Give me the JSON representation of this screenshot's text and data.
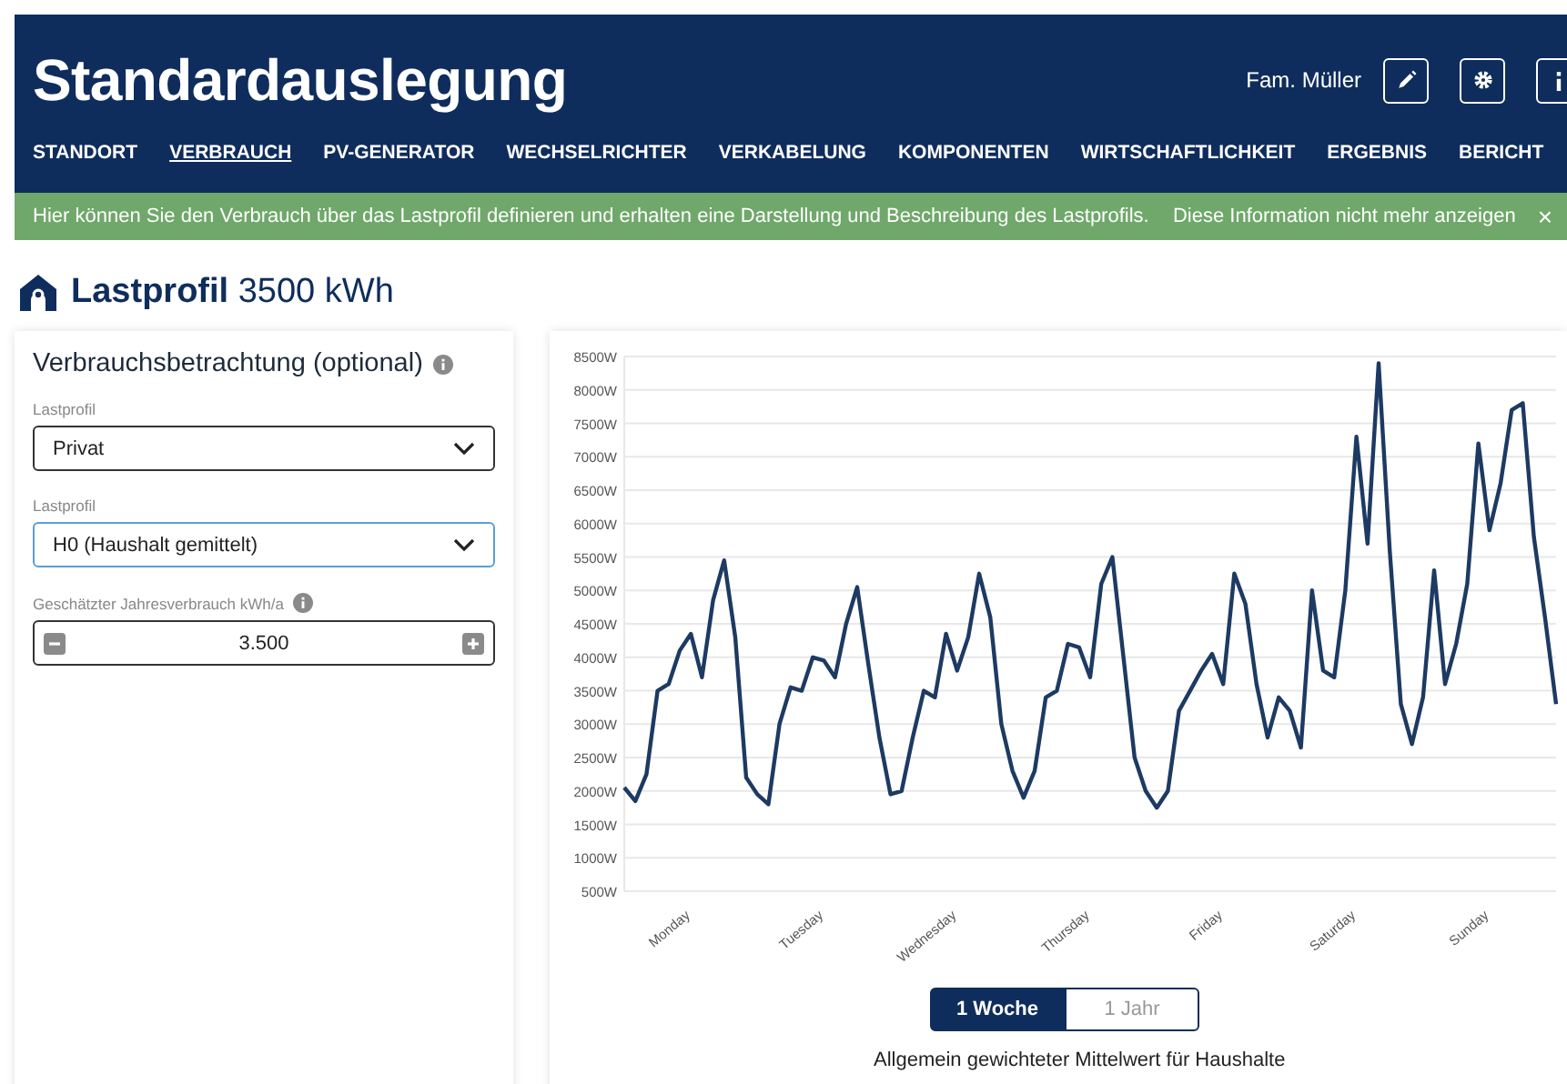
{
  "header": {
    "title": "Standardauslegung",
    "user": "Fam. Müller",
    "buttons": [
      {
        "kind": "edit"
      },
      {
        "kind": "settings"
      },
      {
        "kind": "info"
      }
    ]
  },
  "nav": [
    {
      "label": "STANDORT",
      "selected": false
    },
    {
      "label": "VERBRAUCH",
      "selected": true
    },
    {
      "label": "PV-GENERATOR",
      "selected": false
    },
    {
      "label": "WECHSELRICHTER",
      "selected": false
    },
    {
      "label": "VERKABELUNG",
      "selected": false
    },
    {
      "label": "KOMPONENTEN",
      "selected": false
    },
    {
      "label": "WIRTSCHAFTLICHKEIT",
      "selected": false
    },
    {
      "label": "ERGEBNIS",
      "selected": false
    },
    {
      "label": "BERICHT",
      "selected": false
    }
  ],
  "info_bar": {
    "text": "Hier können Sie den Verbrauch über das Lastprofil definieren und erhalten eine Darstellung und Beschreibung des Lastprofils.",
    "dismiss": "Diese Information nicht mehr anzeigen",
    "close": "×"
  },
  "section": {
    "title": "Lastprofil",
    "value": "3500 kWh"
  },
  "form": {
    "title": "Verbrauchsbetrachtung (optional)",
    "fields": [
      {
        "kind": "select",
        "label": "Lastprofil",
        "value": "Privat",
        "focused": false
      },
      {
        "kind": "select",
        "label": "Lastprofil",
        "value": "H0 (Haushalt gemittelt)",
        "focused": true
      },
      {
        "kind": "stepper",
        "label": "Geschätzter Jahresverbrauch kWh/a",
        "value": "3.500",
        "info": true
      }
    ]
  },
  "chart": {
    "chart_data": {
      "type": "line",
      "categories": [
        null,
        null,
        null,
        null,
        null,
        null,
        "Monday",
        null,
        null,
        null,
        null,
        null,
        null,
        null,
        null,
        null,
        null,
        null,
        "Tuesday",
        null,
        null,
        null,
        null,
        null,
        null,
        null,
        null,
        null,
        null,
        null,
        "Wednesday",
        null,
        null,
        null,
        null,
        null,
        null,
        null,
        null,
        null,
        null,
        null,
        "Thursday",
        null,
        null,
        null,
        null,
        null,
        null,
        null,
        null,
        null,
        null,
        null,
        "Friday",
        null,
        null,
        null,
        null,
        null,
        null,
        null,
        null,
        null,
        null,
        null,
        "Saturday",
        null,
        null,
        null,
        null,
        null,
        null,
        null,
        null,
        null,
        null,
        null,
        "Sunday",
        null,
        null,
        null,
        null,
        null,
        null
      ],
      "series": [
        {
          "color": "#1d3a63",
          "values": [
            2050,
            1850,
            2250,
            3500,
            3600,
            4100,
            4350,
            3700,
            4850,
            5450,
            4300,
            2200,
            1950,
            1800,
            3000,
            3550,
            3500,
            4000,
            3950,
            3700,
            4500,
            5050,
            3900,
            2800,
            1950,
            2000,
            2800,
            3500,
            3400,
            4350,
            3800,
            4300,
            5250,
            4600,
            3000,
            2300,
            1900,
            2300,
            3400,
            3500,
            4200,
            4150,
            3700,
            5100,
            5500,
            4000,
            2500,
            2000,
            1750,
            2000,
            3200,
            3500,
            3800,
            4050,
            3600,
            5250,
            4800,
            3600,
            2800,
            3400,
            3200,
            2650,
            5000,
            3800,
            3700,
            5000,
            7300,
            5700,
            8400,
            5600,
            3300,
            2700,
            3400,
            5300,
            3600,
            4200,
            5100,
            7200,
            5900,
            6600,
            7700,
            7800,
            5800,
            4600,
            3300
          ]
        }
      ],
      "ylim": [
        500,
        8500
      ],
      "grid": true,
      "yticks": [
        {
          "value": 500,
          "label": "500W"
        },
        {
          "value": 1000,
          "label": "1000W"
        },
        {
          "value": 1500,
          "label": "1500W"
        },
        {
          "value": 2000,
          "label": "2000W"
        },
        {
          "value": 2500,
          "label": "2500W"
        },
        {
          "value": 3000,
          "label": "3000W"
        },
        {
          "value": 3500,
          "label": "3500W"
        },
        {
          "value": 4000,
          "label": "4000W"
        },
        {
          "value": 4500,
          "label": "4500W"
        },
        {
          "value": 5000,
          "label": "5000W"
        },
        {
          "value": 5500,
          "label": "5500W"
        },
        {
          "value": 6000,
          "label": "6000W"
        },
        {
          "value": 6500,
          "label": "6500W"
        },
        {
          "value": 7000,
          "label": "7000W"
        },
        {
          "value": 7500,
          "label": "7500W"
        },
        {
          "value": 8000,
          "label": "8000W"
        },
        {
          "value": 8500,
          "label": "8500W"
        }
      ]
    },
    "toggle": [
      {
        "label": "1 Woche",
        "selected": true
      },
      {
        "label": "1 Jahr",
        "selected": false
      }
    ],
    "caption": "Allgemein gewichteter Mittelwert für Haushalte"
  }
}
